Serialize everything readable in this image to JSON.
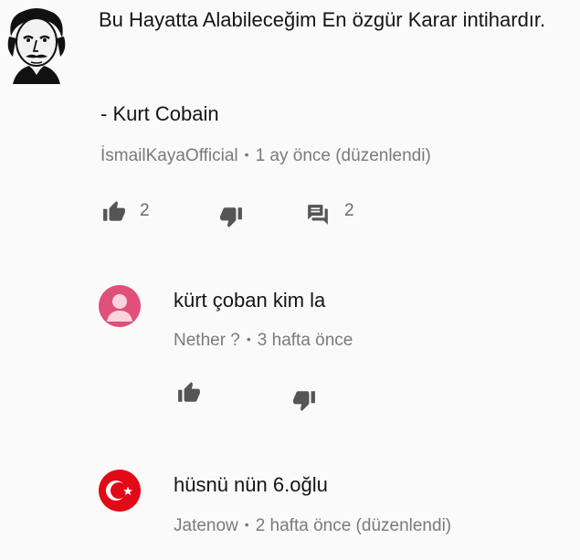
{
  "main_comment": {
    "text": "Bu Hayatta Alabileceğim En özgür Karar intihardır.",
    "quote_author": "- Kurt Cobain",
    "author": "İsmailKayaOfficial",
    "separator": "•",
    "time": "1 ay önce (düzenlendi)",
    "like_count": "2",
    "reply_count": "2"
  },
  "replies": [
    {
      "text": "kürt çoban kim la",
      "author": "Nether ?",
      "separator": "•",
      "time": "3 hafta önce",
      "avatar_color": "#e0507a"
    },
    {
      "text": "hüsnü nün 6.oğlu",
      "author": "Jatenow",
      "separator": "•",
      "time": "2 hafta önce (düzenlendi)",
      "avatar_color": "#e30a17"
    }
  ],
  "colors": {
    "icon": "#555555",
    "meta": "#7a7a7a",
    "background": "#fafafa"
  },
  "icons": {
    "like": "thumb-up-icon",
    "dislike": "thumb-down-icon",
    "reply": "comment-icon"
  }
}
